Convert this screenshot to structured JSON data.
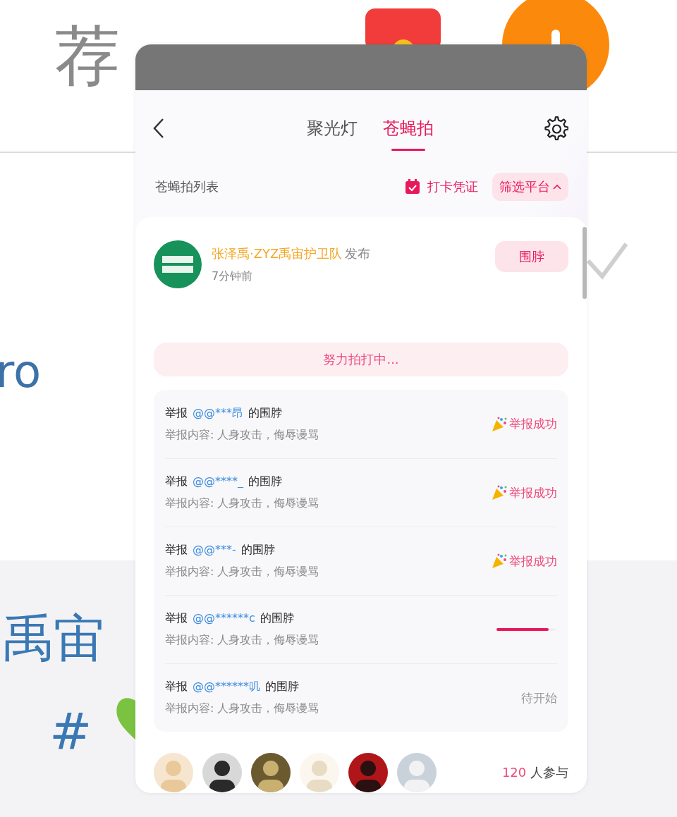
{
  "backdrop": {
    "title": "荐",
    "snippet": "ro",
    "text_left_1": "禹宙",
    "text_left_2": "#"
  },
  "panel": {
    "tabs": [
      {
        "label": "聚光灯",
        "selected": false
      },
      {
        "label": "苍蝇拍",
        "selected": true
      }
    ],
    "list_title": "苍蝇拍列表",
    "checkin_link": "打卡凭证",
    "filter_button": "筛选平台",
    "post": {
      "author": "张泽禹·ZYZ禹宙护卫队",
      "action": "发布",
      "time": "7分钟前",
      "button": "围脖"
    },
    "progress_text": "努力拍打中...",
    "reports": [
      {
        "kind": "success",
        "prefix": "举报",
        "mention": "@@***昂",
        "suffix": "的围脖",
        "detail": "举报内容: 人身攻击，侮辱谩骂",
        "status": "举报成功"
      },
      {
        "kind": "success",
        "prefix": "举报",
        "mention": "@@****_",
        "suffix": "的围脖",
        "detail": "举报内容: 人身攻击，侮辱谩骂",
        "status": "举报成功"
      },
      {
        "kind": "success",
        "prefix": "举报",
        "mention": "@@***-",
        "suffix": "的围脖",
        "detail": "举报内容: 人身攻击，侮辱谩骂",
        "status": "举报成功"
      },
      {
        "kind": "progress",
        "prefix": "举报",
        "mention": "@@******c",
        "suffix": "的围脖",
        "detail": "举报内容: 人身攻击，侮辱谩骂",
        "level": 0.88
      },
      {
        "kind": "pending",
        "prefix": "举报",
        "mention": "@@******叽",
        "suffix": "的围脖",
        "detail": "举报内容: 人身攻击，侮辱谩骂",
        "status": "待开始"
      }
    ],
    "participants": {
      "count": "120",
      "label": "人参与"
    }
  }
}
